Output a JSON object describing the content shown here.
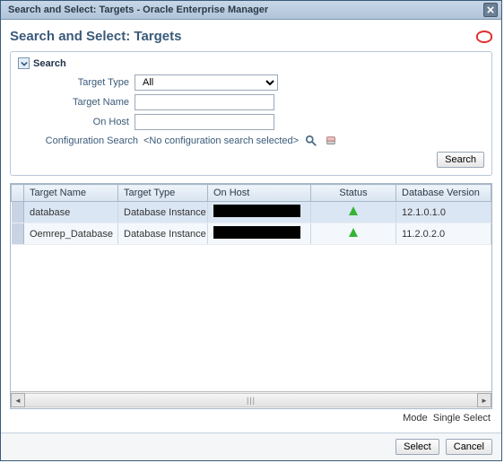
{
  "window": {
    "title": "Search and Select: Targets - Oracle Enterprise Manager"
  },
  "page": {
    "title": "Search and Select: Targets"
  },
  "search": {
    "section_label": "Search",
    "target_type_label": "Target Type",
    "target_type_value": "All",
    "target_name_label": "Target Name",
    "target_name_value": "",
    "on_host_label": "On Host",
    "on_host_value": "",
    "config_search_label": "Configuration Search",
    "config_search_text": "<No configuration search selected>",
    "search_button": "Search"
  },
  "grid": {
    "headers": {
      "selector": "",
      "target_name": "Target Name",
      "target_type": "Target Type",
      "on_host": "On Host",
      "status": "Status",
      "db_version": "Database Version"
    },
    "rows": [
      {
        "target_name": "database",
        "target_type": "Database Instance",
        "on_host": "[redacted]",
        "status": "up",
        "db_version": "12.1.0.1.0",
        "selected": true
      },
      {
        "target_name": "Oemrep_Database",
        "target_type": "Database Instance",
        "on_host": "[redacted]",
        "status": "up",
        "db_version": "11.2.0.2.0",
        "selected": false
      }
    ]
  },
  "mode": {
    "label": "Mode",
    "value": "Single Select"
  },
  "footer": {
    "select": "Select",
    "cancel": "Cancel"
  },
  "icons": {
    "close": "×",
    "collapse": "⌄",
    "magnifier": "search",
    "eraser": "eraser",
    "status_up": "up"
  },
  "colors": {
    "accent": "#3a5a7a",
    "header_bg_top": "#c8d8e8",
    "header_bg_bottom": "#b0c4d8",
    "status_up": "#35b435",
    "oracle_red": "#e03030"
  }
}
